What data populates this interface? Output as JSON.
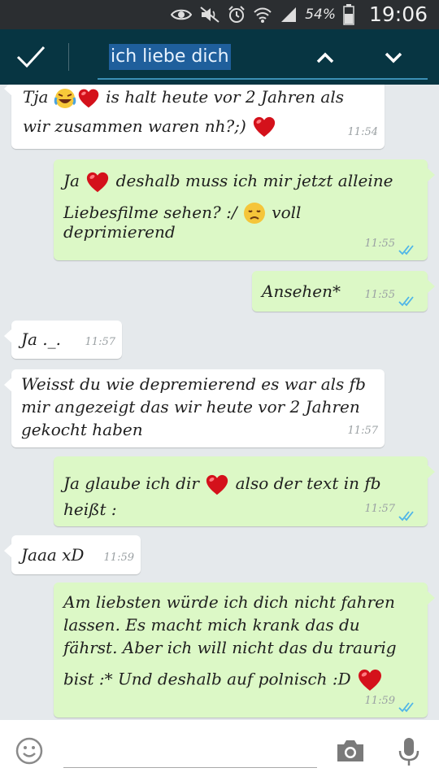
{
  "status_bar": {
    "battery_percent": "54%",
    "time": "19:06"
  },
  "search": {
    "query": "ich liebe dich"
  },
  "messages": [
    {
      "dir": "in",
      "line1_a": "Tja ",
      "line1_b": " is halt heute vor 2 Jahren als",
      "line2": "wir zusammen waren nh?;) ",
      "time": "11:54"
    },
    {
      "dir": "out",
      "line1_a": "Ja ",
      "line1_b": " deshalb muss ich mir jetzt alleine",
      "line2_a": "Liebesfilme sehen? :/ ",
      "line2_b": " voll",
      "line3": "deprimierend",
      "time": "11:55"
    },
    {
      "dir": "out",
      "text": "Ansehen*",
      "time": "11:55"
    },
    {
      "dir": "in",
      "text": "Ja ._.",
      "time": "11:57"
    },
    {
      "dir": "in",
      "line1": "Weisst du wie depremierend es war als fb",
      "line2": "mir angezeigt das wir heute vor 2 Jahren",
      "line3": "gekocht haben",
      "time": "11:57"
    },
    {
      "dir": "out",
      "line1_a": "Ja glaube ich dir ",
      "line1_b": " also der text in fb",
      "line2": "heißt :",
      "time": "11:57"
    },
    {
      "dir": "in",
      "text": "Jaaa xD",
      "time": "11:59"
    },
    {
      "dir": "out",
      "line1": "Am liebsten würde ich dich nicht fahren",
      "line2": "lassen. Es macht mich krank das du",
      "line3": "fährst. Aber ich will nicht das du traurig",
      "line4": "bist :* Und deshalb auf polnisch :D ",
      "time": "11:59"
    }
  ],
  "colors": {
    "header": "#073542",
    "incoming": "#ffffff",
    "outgoing": "#dcf8c6",
    "read_ticks": "#4fb5e8",
    "background": "#e5e9ec"
  },
  "icons": [
    "eye-icon",
    "mute-icon",
    "alarm-icon",
    "wifi-icon",
    "signal-icon",
    "battery-icon",
    "check-icon",
    "chevron-up-icon",
    "chevron-down-icon",
    "heart-emoji",
    "laughing-emoji",
    "disappointed-emoji",
    "smiley-icon",
    "camera-icon",
    "mic-icon"
  ]
}
